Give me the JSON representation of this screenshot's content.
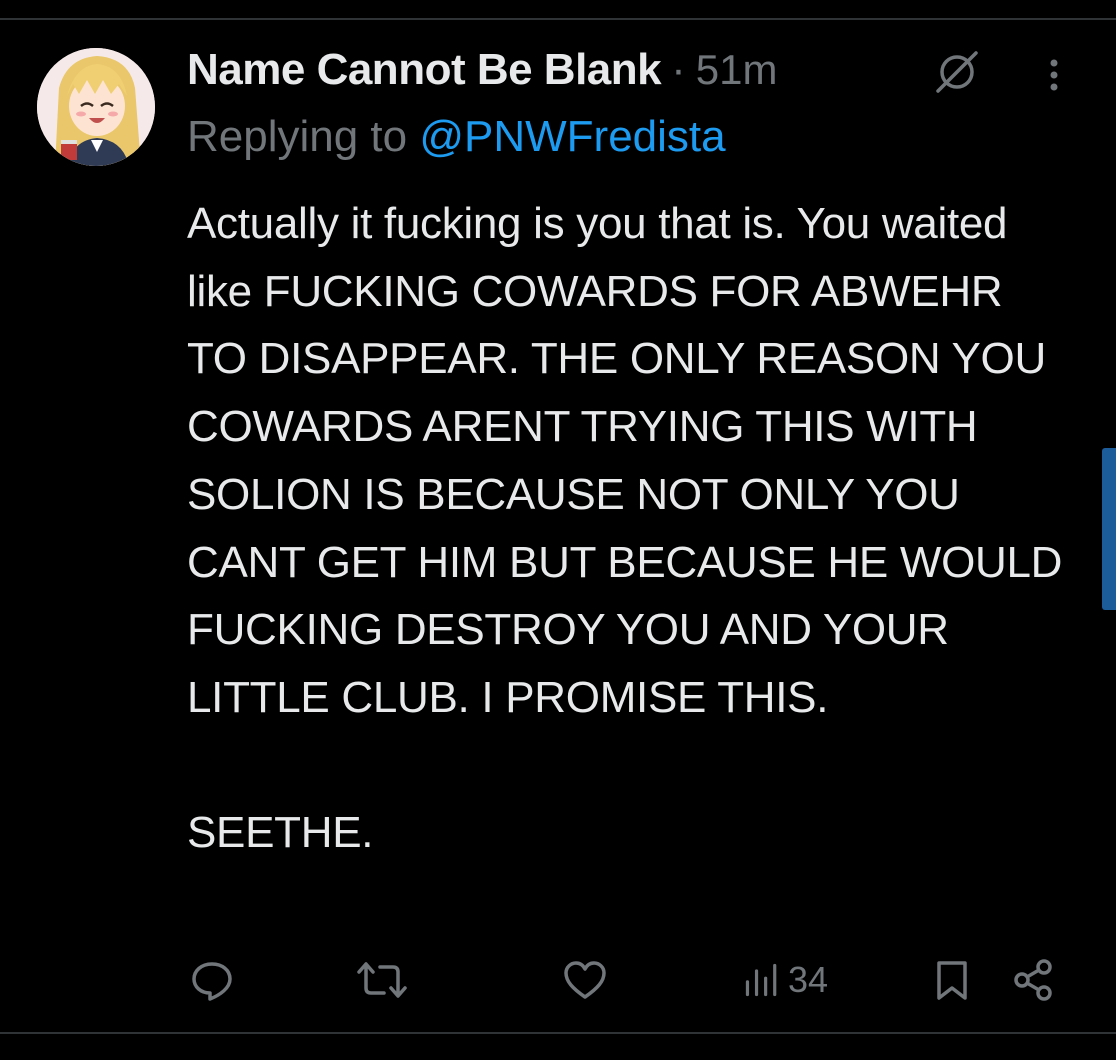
{
  "tweet": {
    "author_name": "Name Cannot Be Blank",
    "separator": "·",
    "timestamp": "51m",
    "replying_prefix": "Replying to ",
    "replying_handle": "@PNWFredista",
    "text": "Actually it fucking is you that is. You waited like FUCKING COWARDS FOR ABWEHR TO DISAPPEAR. THE ONLY REASON YOU COWARDS ARENT TRYING THIS WITH SOLION IS BECAUSE NOT ONLY YOU CANT GET HIM BUT BECAUSE HE WOULD FUCKING DESTROY YOU AND YOUR LITTLE CLUB. I PROMISE THIS.\n\nSEETHE."
  },
  "actions": {
    "views_count": "34"
  },
  "icons": {
    "reply": "reply-icon",
    "repost": "repost-icon",
    "like": "heart-icon",
    "views": "analytics-icon",
    "bookmark": "bookmark-icon",
    "share": "share-icon",
    "grok": "grok-icon",
    "more": "more-icon"
  },
  "colors": {
    "background": "#000000",
    "text": "#e7e9ea",
    "muted": "#71767b",
    "accent": "#1d9bf0"
  }
}
